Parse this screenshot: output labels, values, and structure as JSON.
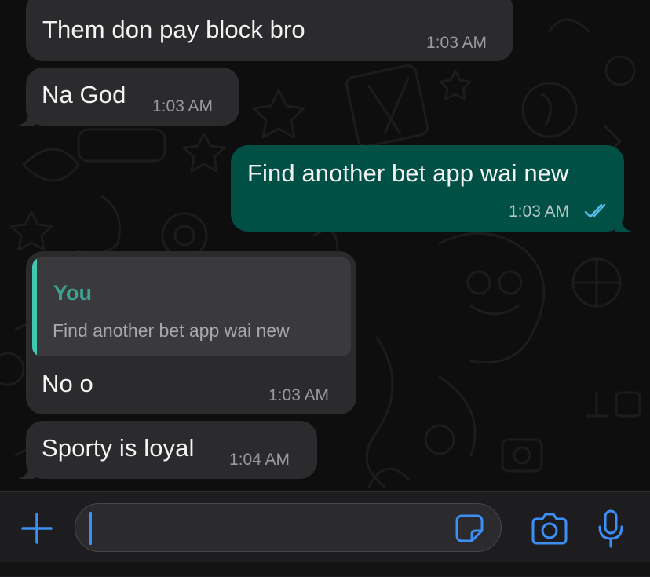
{
  "messages": [
    {
      "id": "m1",
      "direction": "incoming",
      "text": "Them don pay block bro",
      "time": "1:03 AM"
    },
    {
      "id": "m2",
      "direction": "incoming",
      "text": "Na God",
      "time": "1:03 AM"
    },
    {
      "id": "m3",
      "direction": "outgoing",
      "text": "Find another bet app wai new",
      "time": "1:03 AM",
      "status": "read"
    },
    {
      "id": "m4",
      "direction": "incoming",
      "quote": {
        "author": "You",
        "text": "Find another bet app wai new"
      },
      "text": "No o",
      "time": "1:03 AM"
    },
    {
      "id": "m5",
      "direction": "incoming",
      "text": "Sporty is loyal",
      "time": "1:04 AM"
    }
  ],
  "composer": {
    "value": "",
    "icons": [
      "plus-icon",
      "sticker-icon",
      "camera-icon",
      "microphone-icon"
    ]
  },
  "colors": {
    "incoming_bubble": "#2b2b2d",
    "outgoing_bubble": "#005046",
    "accent": "#3d8ef5",
    "read_ticks": "#53bdeb",
    "quote_bar": "#3fc9b0"
  }
}
